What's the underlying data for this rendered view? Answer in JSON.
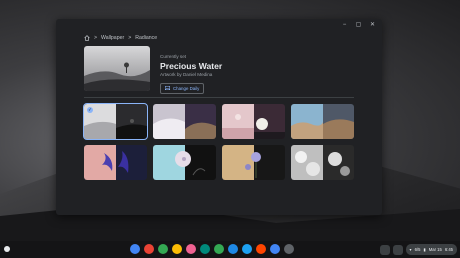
{
  "window": {
    "controls": [
      "−",
      "▢",
      "✕"
    ]
  },
  "breadcrumb": {
    "home_icon": "home-icon",
    "items": [
      "Wallpaper",
      "Radiance"
    ],
    "separator": ">"
  },
  "current": {
    "label": "Currently set",
    "title": "Precious Water",
    "artist": "Artwork by Daniel Medina",
    "change_button": "Change Daily"
  },
  "tiles": [
    {
      "name": "desert-dune-tree",
      "selected": true
    },
    {
      "name": "white-dunes-hills",
      "selected": false
    },
    {
      "name": "pink-sun-moon",
      "selected": false
    },
    {
      "name": "rocky-desert-cliff",
      "selected": false
    },
    {
      "name": "purple-iris-flower",
      "selected": false
    },
    {
      "name": "white-flower-blue",
      "selected": false
    },
    {
      "name": "lavender-flower-dark",
      "selected": false
    },
    {
      "name": "white-flowers-mono",
      "selected": false
    }
  ],
  "shelf": {
    "apps": [
      "chrome",
      "gmail",
      "calendar",
      "drive",
      "photos",
      "chat",
      "meet",
      "play",
      "twitter",
      "reddit",
      "docs",
      "settings"
    ],
    "app_colors": [
      "#4285f4",
      "#ea4335",
      "#34a853",
      "#fbbc04",
      "#f06292",
      "#00897b",
      "#34a853",
      "#1e88e5",
      "#1da1f2",
      "#ff4500",
      "#4285f4",
      "#5f6368"
    ],
    "battery": "6/5",
    "date": "Mar 15",
    "time": "6:45"
  },
  "colors": {
    "accent": "#8ab4f8",
    "window_bg": "#202124"
  }
}
